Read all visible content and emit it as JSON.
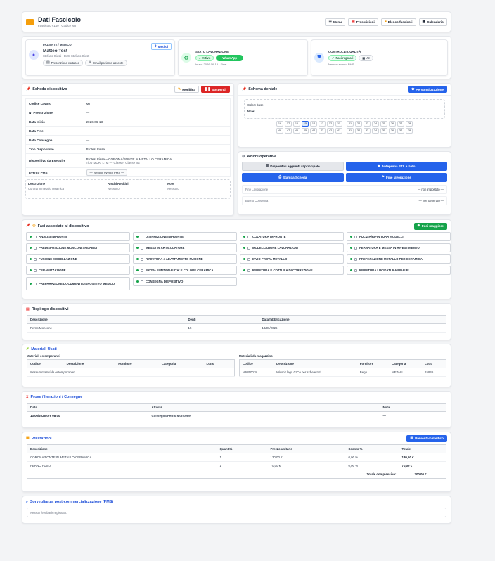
{
  "header": {
    "title": "Dati Fascicolo",
    "subtitle": "Fascicolo #149 · Codice MT",
    "buttons": {
      "menu": "Menu",
      "prescrizioni": "Prescrizioni",
      "elenco": "Elenco fascicoli",
      "calendario": "Calendario"
    }
  },
  "patient": {
    "section_label": "PAZIENTE / MEDICO",
    "name": "Matteo Test",
    "doctors": "Stefano Giusti · Dott. Stefano Giusti",
    "medici_button": "Medici",
    "chips": [
      "Prescrizione cartacea",
      "Email paziente assente"
    ]
  },
  "status": {
    "label": "STATO LAVORAZIONE",
    "badge_active": "Attivo",
    "badge_whatsapp": "WhatsApp",
    "meta": "Inizio: 2026-06-13 · Fine: —"
  },
  "quality": {
    "label": "CONTROLLI QUALITÀ",
    "chip_phases": "Fasi regolari",
    "chip_ai": "AI",
    "meta": "Nessun evento PMS"
  },
  "device": {
    "title": "Scheda dispositivo",
    "edit_button": "Modifica",
    "suspend_button": "Sospendi",
    "rows": [
      {
        "k": "Codice Lavoro",
        "v": "MT"
      },
      {
        "k": "N° Prescrizione",
        "v": "—"
      },
      {
        "k": "Data Inizio",
        "v": "2026-06-13"
      },
      {
        "k": "Data Fine",
        "v": "—"
      },
      {
        "k": "Data Consegna",
        "v": "—"
      },
      {
        "k": "Tipo Dispositivo",
        "v": "Protesi Fissa"
      }
    ],
    "device_label": "Dispositivo da Eseguire",
    "device_line1": "Protesi Fissa – CORONA/PONTE in METALLO CERAMICA",
    "device_line2": "Tipo MDR: LTM — Classe: Classe IIa",
    "pms_label": "Evento PMS",
    "pms_value": "— Nessun evento PMS —",
    "extra": [
      {
        "k": "Descrizione",
        "v": "Corona in metallo ceramica"
      },
      {
        "k": "Rischi Residui",
        "v": "Nessuno"
      },
      {
        "k": "Note",
        "v": "Nessuno"
      }
    ]
  },
  "dental": {
    "title": "Schema dentale",
    "customize_button": "Personalizzazione",
    "colore_label": "Colore base: —",
    "note_label": "Note:",
    "upper": [
      "18",
      "17",
      "16",
      "15",
      "14",
      "13",
      "12",
      "11",
      "21",
      "22",
      "23",
      "24",
      "25",
      "26",
      "27",
      "28"
    ],
    "lower": [
      "48",
      "47",
      "46",
      "45",
      "44",
      "43",
      "42",
      "41",
      "31",
      "32",
      "33",
      "34",
      "35",
      "36",
      "37",
      "38"
    ],
    "selected": "15"
  },
  "actions": {
    "title": "Azioni operative",
    "btn_devices": "Dispositivi aggiunti al principale",
    "btn_stl": "Anteprima STL e Foto",
    "btn_print": "Stampa Scheda",
    "btn_end": "Fine lavorazione",
    "fine_label": "Fine Lavorazione",
    "fine_value": "— non impostato —",
    "buono_label": "Buono Consegna",
    "buono_value": "— non generato —"
  },
  "phases": {
    "title": "Fasi associate al dispositivo",
    "add_button": "Fasi maggiore",
    "items": [
      [
        "ANALISI IMPRONTE",
        "DISINFEZIONE IMPRONTE",
        "COLATURA IMPRONTE",
        "PULIZIA/RIFINITURA MODELLI"
      ],
      [
        "PREDISPOSIZIONE MONCONI SFILABILI",
        "MESSA IN ARTICOLATORE",
        "MODELLAZIONE LAVORAZIONI",
        "PERNATURA E MESSA IN RIVESTIMENTO"
      ],
      [
        "FUSIONE MODELLAZIONE",
        "RIFINITURA e ADATTAMENTO FUSIONE",
        "INVIO PROVA METALLO",
        "PREPARAZIONE METALLO PER CERAMICA"
      ],
      [
        "CERAMIZZAZIONE",
        "PROVA FUNZIONALITA' E COLORE CERAMICA",
        "RIFINITURA E COTTURA DI CORREZIONE",
        "RIFINITURA LUCIDATURA FINALE"
      ],
      [
        "PREPARAZIONE DOCUMENTI DISPOSITIVO MEDICO",
        "CONSEGNA DISPOSITIVO"
      ]
    ]
  },
  "summary": {
    "title": "Riepilogo dispositivi",
    "headers": [
      "Descrizione",
      "Denti",
      "Data fabbricazione"
    ],
    "rows": [
      [
        "Perno Moncone",
        "15",
        "13/06/2026"
      ]
    ]
  },
  "materials": {
    "title": "Materiali Usati",
    "ext_title": "Materiali estemporanei",
    "ext_headers": [
      "Codice",
      "Descrizione",
      "Fornitore",
      "Categoria",
      "Lotto"
    ],
    "ext_empty": "Nessun materiale estemporaneo.",
    "mag_title": "Materiali da magazzino",
    "mag_headers": [
      "Codice",
      "Descrizione",
      "Fornitore",
      "Categoria",
      "Lotto"
    ],
    "mag_rows": [
      [
        "M6850018",
        "Wironit lega CrCo per scheletrati",
        "Bego",
        "METALLI",
        "15946"
      ]
    ]
  },
  "trials": {
    "title": "Prove / Iterazioni / Consegne",
    "headers": [
      "Data",
      "Attività",
      "Nota"
    ],
    "rows": [
      [
        "13/06/2026 ore 08:00",
        "Consegna Perno Moncone",
        "—"
      ]
    ]
  },
  "services": {
    "title": "Prestazioni",
    "quote_button": "Preventivo medico",
    "headers": [
      "Descrizione",
      "Quantità",
      "Prezzo unitario",
      "Sconto %",
      "Totale"
    ],
    "rows": [
      [
        "CORONA/PONTE IN METALLO-CERAMICA",
        "1",
        "130,00 €",
        "0,00 %",
        "130,00 €"
      ],
      [
        "PERNO FUSO",
        "1",
        "70,00 €",
        "0,00 %",
        "70,00 €"
      ]
    ],
    "total_label": "Totale complessivo:",
    "total_value": "200,00 €"
  },
  "pms": {
    "title": "Sorveglianza post-commercializzazione (PMS)",
    "empty": "Nessun feedback registrato."
  },
  "colors": {
    "accent": "#2563eb",
    "danger": "#dc2626",
    "success": "#16a34a"
  }
}
